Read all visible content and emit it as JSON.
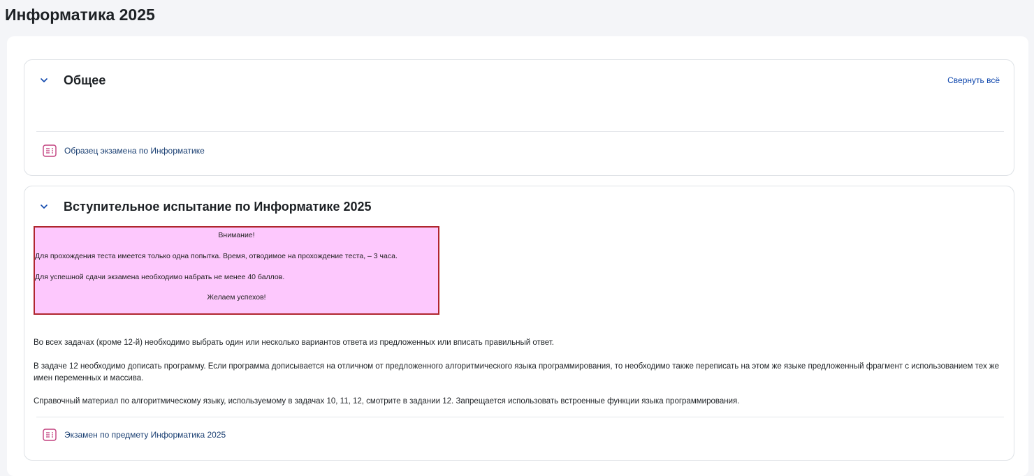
{
  "page_title": "Информатика 2025",
  "collapse_all_label": "Свернуть всё",
  "sections": [
    {
      "title": "Общее",
      "activity": "Образец экзамена по Информатике"
    },
    {
      "title": "Вступительное испытание по Информатике 2025",
      "notice": {
        "heading": "Внимание!",
        "line1": "Для прохождения теста имеется только одна попытка. Время, отводимое на прохождение теста, – 3 часа.",
        "line2": "Для успешной сдачи экзамена необходимо набрать не менее 40 баллов.",
        "closing": "Желаем успехов!"
      },
      "paragraphs": [
        "Во всех задачах (кроме 12-й) необходимо выбрать один или несколько вариантов ответа из предложенных или вписать правильный ответ.",
        "В задаче 12 необходимо дописать программу. Если программа дописывается на отличном от предложенного алгоритмического языка программирования, то необходимо также переписать на этом же языке предложенный фрагмент с использованием тех же имен переменных и массива.",
        "Справочный материал по алгоритмическому языку, используемому в задачах 10, 11, 12, смотрите в задании 12. Запрещается использовать встроенные функции языка программирования."
      ],
      "activity": "Экзамен по предмету Информатика 2025"
    }
  ],
  "icons": {
    "chevron": "chevron-down-icon",
    "activity": "quiz-icon"
  },
  "colors": {
    "notice_bg": "#fdc8fd",
    "notice_border": "#b0262e",
    "quiz_icon": "#c2407f",
    "link": "#0f47ad"
  }
}
